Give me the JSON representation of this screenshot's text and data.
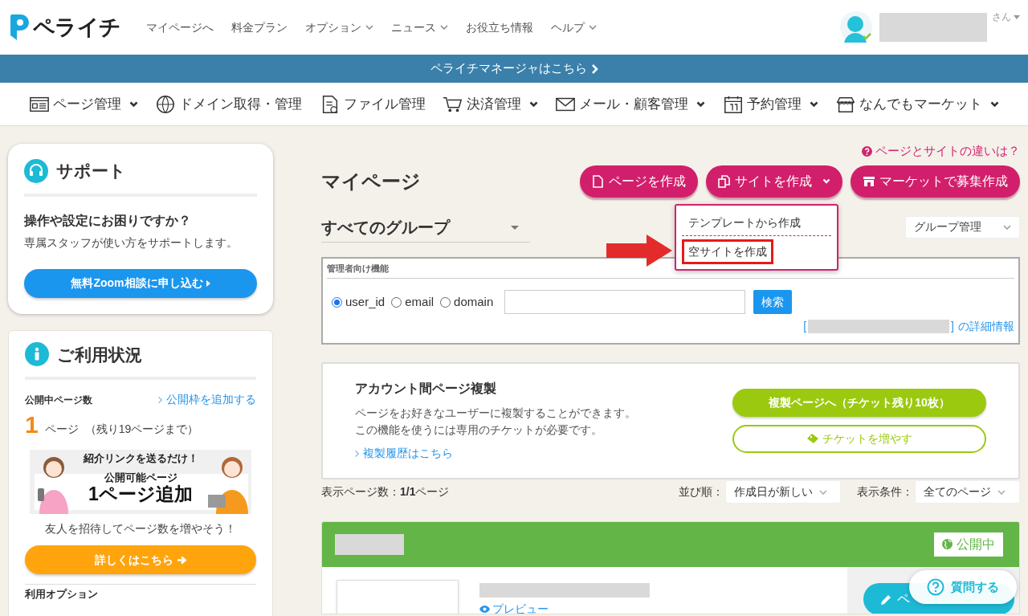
{
  "header": {
    "logo": "ペライチ",
    "nav": [
      {
        "label": "マイページへ",
        "dropdown": false
      },
      {
        "label": "料金プラン",
        "dropdown": false
      },
      {
        "label": "オプション",
        "dropdown": true
      },
      {
        "label": "ニュース",
        "dropdown": true
      },
      {
        "label": "お役立ち情報",
        "dropdown": false
      },
      {
        "label": "ヘルプ",
        "dropdown": true
      }
    ],
    "user_suffix": "さん"
  },
  "manager_bar": "ペライチマネージャはこちら",
  "menu": [
    {
      "kind": "page",
      "label": "ページ管理",
      "dropdown": true
    },
    {
      "kind": "domain",
      "label": "ドメイン取得・管理",
      "dropdown": false
    },
    {
      "kind": "file",
      "label": "ファイル管理",
      "dropdown": false
    },
    {
      "kind": "cart",
      "label": "決済管理",
      "dropdown": true
    },
    {
      "kind": "mail",
      "label": "メール・顧客管理",
      "dropdown": true
    },
    {
      "kind": "calendar",
      "label": "予約管理",
      "dropdown": true
    },
    {
      "kind": "shop",
      "label": "なんでもマーケット",
      "dropdown": true
    }
  ],
  "support": {
    "title": "サポート",
    "question": "操作や設定にお困りですか？",
    "description": "専属スタッフが使い方をサポートします。",
    "button": "無料Zoom相談に申し込む"
  },
  "usage": {
    "title": "ご利用状況",
    "label": "公開中ページ数",
    "add_link": "公開枠を追加する",
    "count": "1",
    "unit": "ページ",
    "remaining": "（残り19ページまで）",
    "promo": {
      "tagline": "紹介リンクを送るだけ！",
      "subtitle": "公開可能ページ",
      "headline": "1ページ追加"
    },
    "invite": "友人を招待してページ数を増やそう！",
    "button": "詳しくはこちら",
    "next_heading": "利用オプション"
  },
  "main": {
    "help_link": "ページとサイトの違いは？",
    "title": "マイページ",
    "actions": [
      {
        "kind": "page",
        "label": "ページを作成",
        "dropdown": false
      },
      {
        "kind": "site",
        "label": "サイトを作成",
        "dropdown": true
      },
      {
        "kind": "market",
        "label": "マーケットで募集作成",
        "dropdown": false
      }
    ],
    "site_menu": [
      {
        "label": "テンプレートから作成",
        "highlighted": false
      },
      {
        "label": "空サイトを作成",
        "highlighted": true
      }
    ],
    "group_select": "すべてのグループ",
    "group_manage": "グループ管理"
  },
  "admin": {
    "title": "管理者向け機能",
    "radios": [
      {
        "label": "user_id",
        "selected": true
      },
      {
        "label": "email",
        "selected": false
      },
      {
        "label": "domain",
        "selected": false
      }
    ],
    "search_button": "検索",
    "open_bracket": "[",
    "close_bracket": "]",
    "detail_link": "の詳細情報"
  },
  "copy": {
    "title": "アカウント間ページ複製",
    "lines": [
      "ページをお好きなユーザーに複製することができます。",
      "この機能を使うには専用のチケットが必要です。"
    ],
    "history_link": "複製履歴はこちら",
    "primary_button": "複製ページへ（チケット残り10枚）",
    "secondary_button": "チケットを増やす"
  },
  "list": {
    "count": "表示ページ数：**1/1**ページ",
    "sort_label": "並び順：",
    "sort": "作成日が新しい",
    "filter_label": "表示条件：",
    "filter": "全てのページ"
  },
  "page_card": {
    "status": "公開中",
    "preview": "プレビュー",
    "edit_button": "ペ"
  },
  "chat_button": "質問する"
}
